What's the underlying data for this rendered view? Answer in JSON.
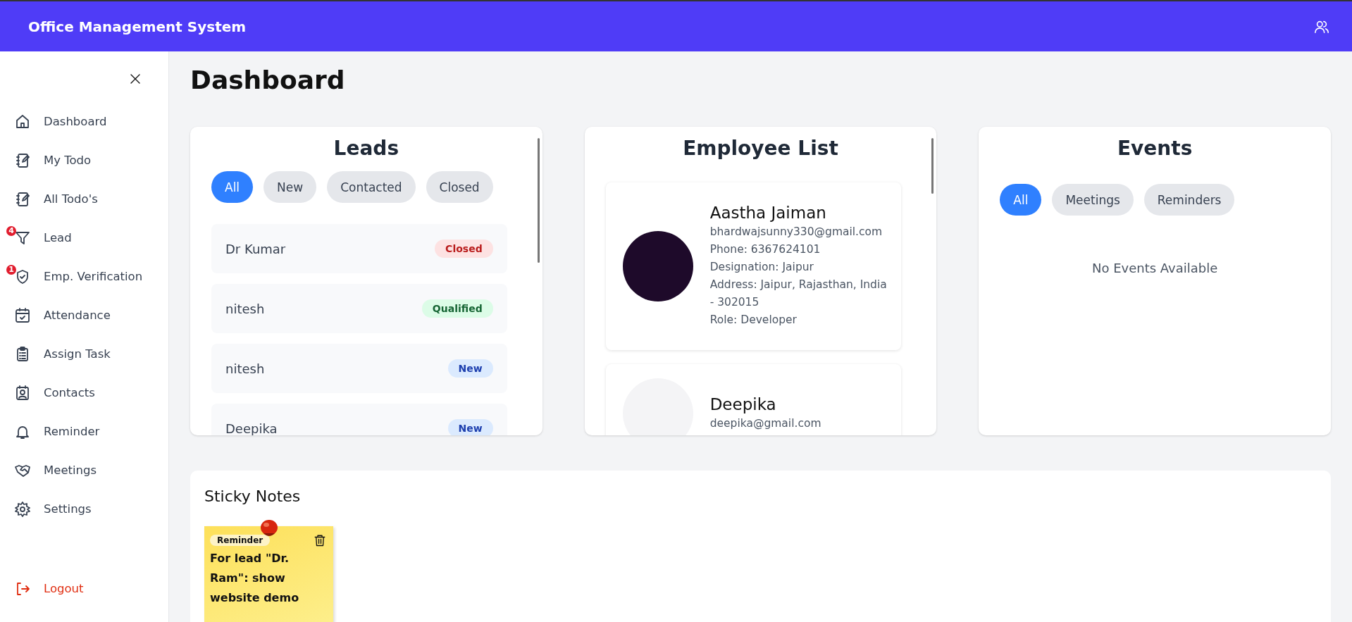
{
  "header": {
    "title": "Office Management System"
  },
  "sidebar": {
    "items": [
      {
        "label": "Dashboard",
        "selected": false
      },
      {
        "label": "My Todo",
        "selected": false
      },
      {
        "label": "All Todo's",
        "selected": false
      },
      {
        "label": "Lead",
        "badge": "4",
        "selected": false
      },
      {
        "label": "Emp. Verification",
        "badge": "1",
        "selected": false
      },
      {
        "label": "Attendance",
        "selected": false
      },
      {
        "label": "Assign Task",
        "selected": false
      },
      {
        "label": "Contacts",
        "selected": false
      },
      {
        "label": "Reminder",
        "selected": false
      },
      {
        "label": "Meetings",
        "selected": false
      },
      {
        "label": "Settings",
        "selected": false
      }
    ],
    "logout": "Logout"
  },
  "page_title": "Dashboard",
  "leads": {
    "title": "Leads",
    "filters": [
      {
        "label": "All",
        "selected": true
      },
      {
        "label": "New",
        "selected": false
      },
      {
        "label": "Contacted",
        "selected": false
      },
      {
        "label": "Closed",
        "selected": false
      }
    ],
    "rows": [
      {
        "name": "Dr Kumar",
        "status": "Closed",
        "kind": "closed"
      },
      {
        "name": "nitesh",
        "status": "Qualified",
        "kind": "qualified"
      },
      {
        "name": "nitesh",
        "status": "New",
        "kind": "new"
      },
      {
        "name": "Deepika",
        "status": "New",
        "kind": "new"
      }
    ]
  },
  "employees": {
    "title": "Employee List",
    "items": [
      {
        "name": "Aastha Jaiman",
        "details": [
          "bhardwajsunny330@gmail.com",
          "Phone: 6367624101",
          "Designation: Jaipur",
          "Address: Jaipur, Rajasthan, India - 302015",
          "Role: Developer"
        ]
      },
      {
        "name": "Deepika",
        "details": [
          "deepika@gmail.com"
        ]
      }
    ]
  },
  "events": {
    "title": "Events",
    "filters": [
      {
        "label": "All",
        "selected": true
      },
      {
        "label": "Meetings",
        "selected": false
      },
      {
        "label": "Reminders",
        "selected": false
      }
    ],
    "empty": "No Events Available"
  },
  "sticky_notes": {
    "title": "Sticky Notes",
    "notes": [
      {
        "tag": "Reminder",
        "text": "For lead \"Dr. Ram\": show website demo"
      }
    ]
  }
}
